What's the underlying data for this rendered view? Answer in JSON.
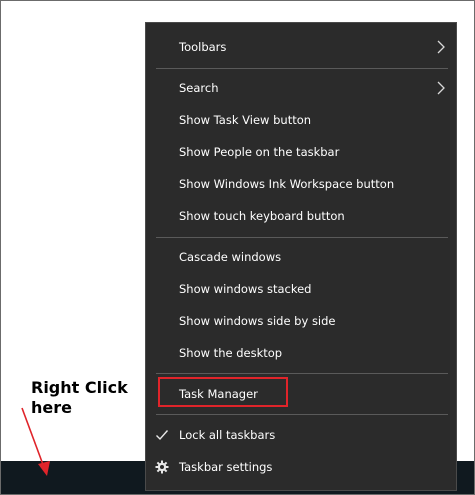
{
  "context_menu": {
    "items": [
      {
        "label": "Toolbars",
        "has_submenu": true
      },
      {
        "label": "Search",
        "has_submenu": true
      },
      {
        "label": "Show Task View button"
      },
      {
        "label": "Show People on the taskbar"
      },
      {
        "label": "Show Windows Ink Workspace button"
      },
      {
        "label": "Show touch keyboard button"
      },
      {
        "label": "Cascade windows"
      },
      {
        "label": "Show windows stacked"
      },
      {
        "label": "Show windows side by side"
      },
      {
        "label": "Show the desktop"
      },
      {
        "label": "Task Manager",
        "highlighted": true
      },
      {
        "label": "Lock all taskbars",
        "icon": "checkmark-icon",
        "checked": true
      },
      {
        "label": "Taskbar settings",
        "icon": "gear-icon"
      }
    ]
  },
  "annotation": {
    "text": "Right Click\nhere",
    "color": "#e0242a"
  },
  "colors": {
    "menu_background": "#2b2b2b",
    "menu_text": "#ffffff",
    "separator": "#5a5a5a",
    "taskbar": "#10191f",
    "highlight_border": "#e0242a"
  }
}
